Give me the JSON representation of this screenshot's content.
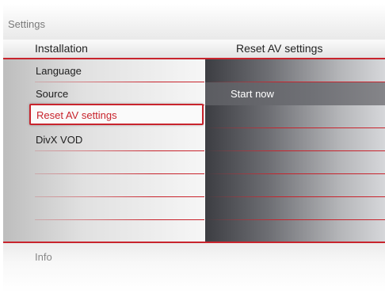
{
  "settings": {
    "title": "Settings"
  },
  "header": {
    "left": "Installation",
    "right": "Reset AV settings"
  },
  "menu": {
    "items": [
      "Language",
      "Source",
      "Reset AV settings",
      "DivX VOD",
      "",
      "",
      "",
      ""
    ],
    "selected": "Reset AV settings"
  },
  "submenu": {
    "items": [
      "",
      "Start now",
      "",
      "",
      "",
      "",
      "",
      ""
    ],
    "highlighted": "Start now"
  },
  "footer": {
    "info": "Info"
  },
  "colors": {
    "accent": "#c8242d"
  }
}
